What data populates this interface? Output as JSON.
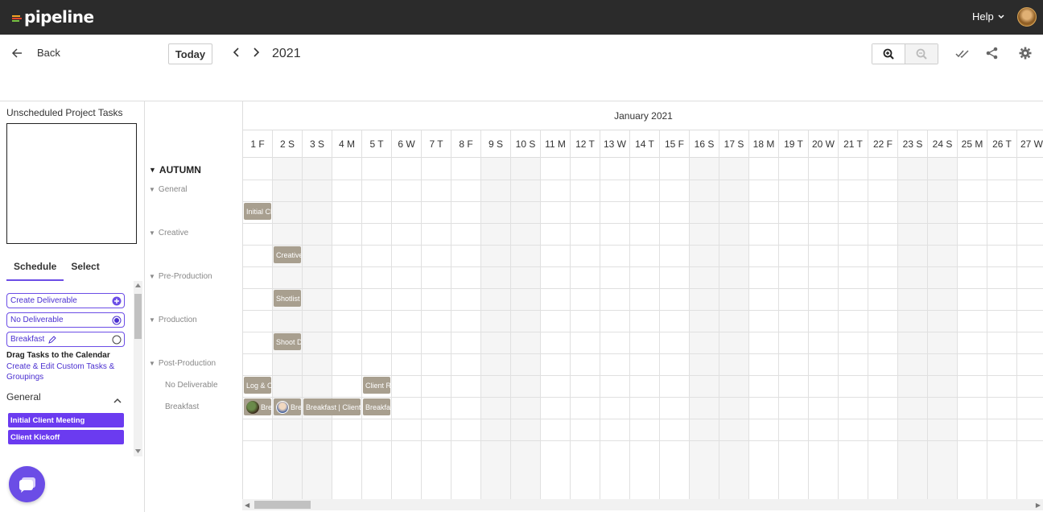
{
  "header": {
    "logo": "pipeline",
    "help_label": "Help"
  },
  "toolbar": {
    "back_label": "Back",
    "today_label": "Today",
    "year": "2021"
  },
  "left_panel": {
    "unscheduled_title": "Unscheduled Project Tasks",
    "tabs": [
      {
        "label": "Schedule",
        "active": true
      },
      {
        "label": "Select",
        "active": false
      }
    ],
    "deliverables": [
      {
        "label": "Create Deliverable",
        "icon": "plus-circle-icon"
      },
      {
        "label": "No Deliverable",
        "icon": "radio-selected-icon"
      },
      {
        "label": "Breakfast",
        "icon": "radio-empty-icon"
      }
    ],
    "drag_title": "Drag Tasks to the Calendar",
    "create_link": "Create & Edit Custom Tasks & Groupings",
    "group_title": "General",
    "tasks": [
      "Initial Client Meeting",
      "Client Kickoff"
    ]
  },
  "tree": {
    "project": "AUTUMN",
    "phases": [
      "General",
      "Creative",
      "Pre-Production",
      "Production",
      "Post-Production"
    ],
    "deliverables": [
      "No Deliverable",
      "Breakfast"
    ]
  },
  "calendar": {
    "month_label": "January 2021",
    "days": [
      "1 F",
      "2 S",
      "3 S",
      "4 M",
      "5 T",
      "6 W",
      "7 T",
      "8 F",
      "9 S",
      "10 S",
      "11 M",
      "12 T",
      "13 W",
      "14 T",
      "15 F",
      "16 S",
      "17 S",
      "18 M",
      "19 T",
      "20 W",
      "21 T",
      "22 F",
      "23 S",
      "24 S",
      "25 M",
      "26 T",
      "27 W"
    ],
    "events": [
      {
        "label": "Initial Client Meeting"
      },
      {
        "label": "Creative Brief"
      },
      {
        "label": "Shotlist"
      },
      {
        "label": "Shoot Day"
      },
      {
        "label": "Log & Organize"
      },
      {
        "label": "Client Review"
      },
      {
        "label": "Breakfast"
      },
      {
        "label": "Breakfast"
      },
      {
        "label": "Breakfast | Client"
      },
      {
        "label": "Breakfast"
      }
    ]
  },
  "colors": {
    "accent": "#6b4de6",
    "event": "#a89f8f",
    "topbar": "#2b2b2b"
  }
}
